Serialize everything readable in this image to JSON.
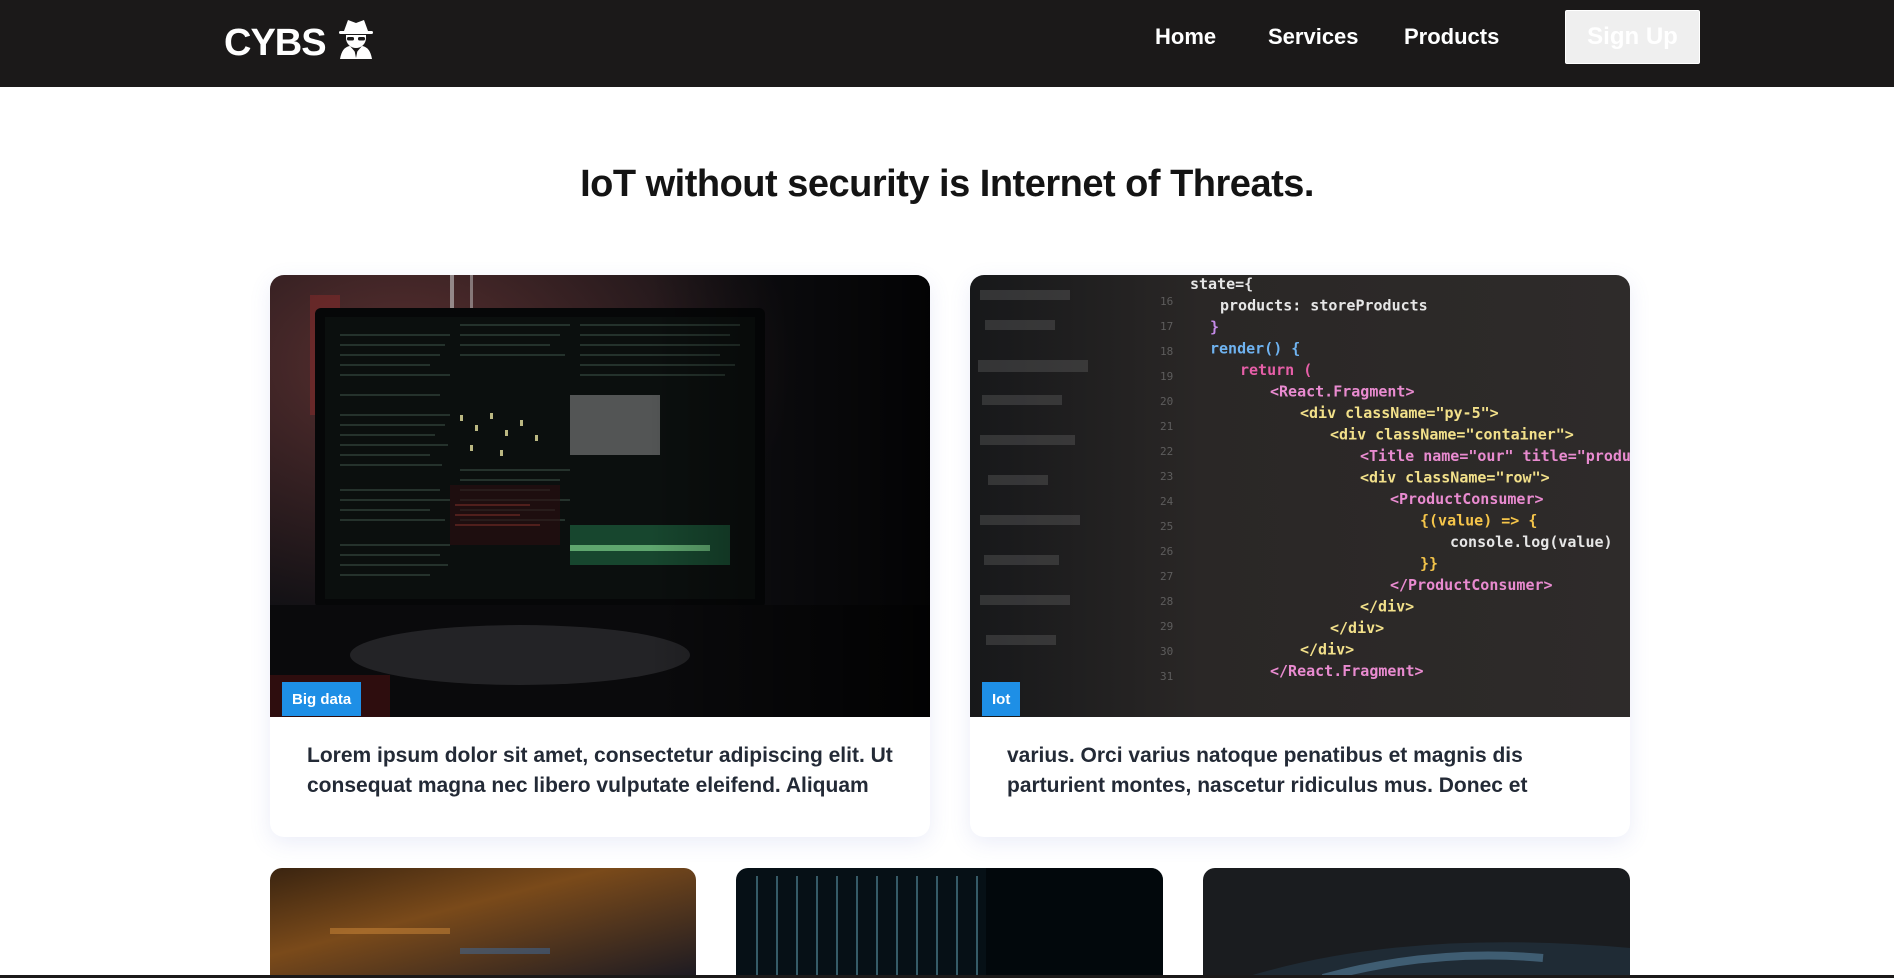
{
  "header": {
    "logo_text": "CYBS",
    "logo_icon": "spy-icon",
    "nav": {
      "home": "Home",
      "services": "Services",
      "products": "Products"
    },
    "signup_label": "Sign Up"
  },
  "main": {
    "headline": "IoT without security is Internet of Threats.",
    "cards": [
      {
        "tag": "Big data",
        "image": "hacker-monitor-terminal-image",
        "text_line1": "Lorem ipsum dolor sit amet, consectetur adipiscing elit. Ut",
        "text_line2": "consequat magna nec libero vulputate eleifend. Aliquam"
      },
      {
        "tag": "Iot",
        "image": "react-code-screen-image",
        "text_line1": "varius. Orci varius natoque penatibus et magnis dis",
        "text_line2": "parturient montes, nascetur ridiculus mus. Donec et",
        "code_lines": [
          "state={",
          "products: storeProducts",
          "}",
          "render() {",
          "return (",
          "<React.Fragment>",
          "<div className=\"py-5\">",
          "<div className=\"container\">",
          "<Title name=\"our\" title=\"product",
          "<div className=\"row\">",
          "<ProductConsumer>",
          "{(value) => {",
          "console.log(value)",
          "}}",
          "</ProductConsumer>",
          "</div>",
          "</div>",
          "</div>",
          "</React.Fragment>"
        ]
      }
    ],
    "thumbnails": [
      "orange-code-blur-image",
      "matrix-data-image",
      "security-screen-image"
    ]
  },
  "colors": {
    "header_bg": "#1b1919",
    "tag_bg": "#1e8fe6",
    "text_dark": "#232a36"
  }
}
